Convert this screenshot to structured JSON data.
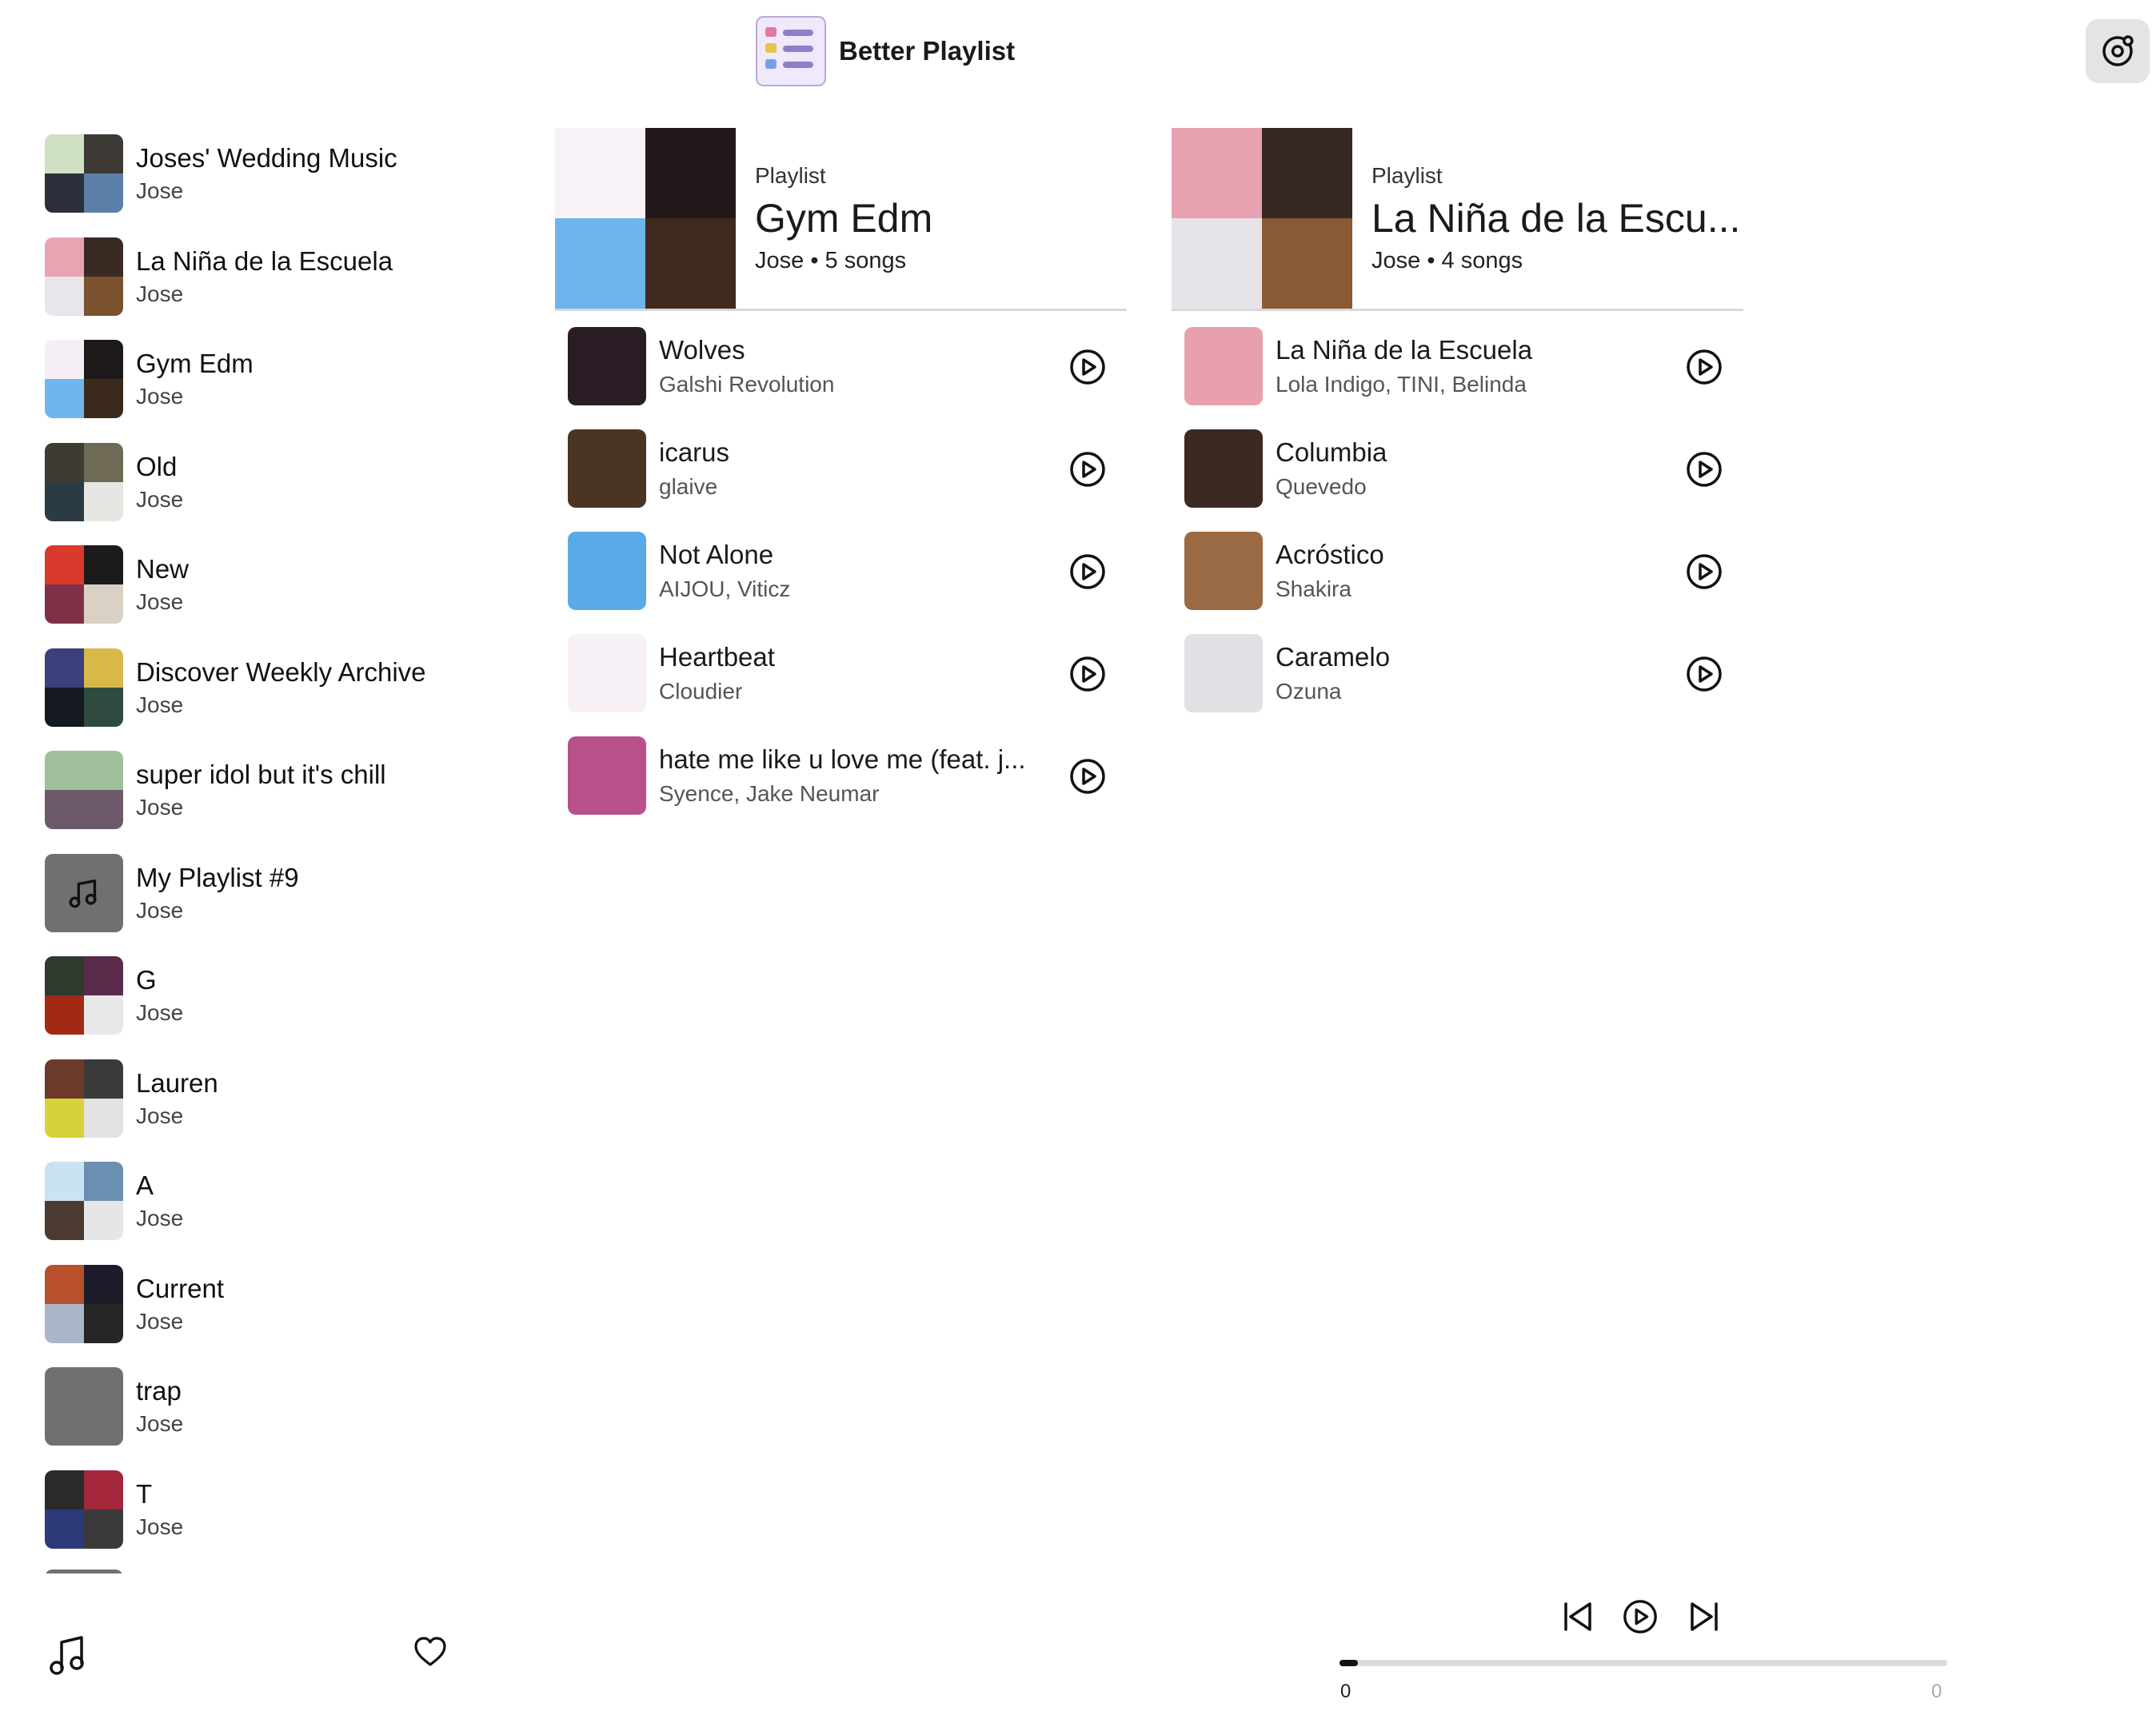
{
  "app": {
    "title": "Better Playlist"
  },
  "icons": {
    "app_logo": "playlist-logo-icon",
    "settings": "spotify-settings-icon",
    "music": "music-note-icon",
    "heart": "heart-icon",
    "play": "play-circle-icon",
    "prev": "skip-previous-icon",
    "next": "skip-next-icon"
  },
  "sidebar": {
    "playlists": [
      {
        "name": "Joses' Wedding Music",
        "owner": "Jose",
        "colors": [
          "#cfe0c4",
          "#3d3a35",
          "#2b2f3a",
          "#5b7fa8"
        ]
      },
      {
        "name": "La Niña de la Escuela",
        "owner": "Jose",
        "colors": [
          "#e9a4b4",
          "#3a2a24",
          "#e8e6ea",
          "#7a5230"
        ]
      },
      {
        "name": "Gym Edm",
        "owner": "Jose",
        "colors": [
          "#f6eef6",
          "#1f1a1a",
          "#6fb6ee",
          "#3a2a1c"
        ]
      },
      {
        "name": "Old",
        "owner": "Jose",
        "colors": [
          "#3e3b33",
          "#6e6a55",
          "#2a3b44",
          "#e6e6e2"
        ]
      },
      {
        "name": "New",
        "owner": "Jose",
        "colors": [
          "#d93a2c",
          "#1b1b1b",
          "#803046",
          "#d9d2c4"
        ]
      },
      {
        "name": "Discover Weekly Archive",
        "owner": "Jose",
        "colors": [
          "#3b3f7a",
          "#d9b84a",
          "#141820",
          "#2f4b40"
        ]
      },
      {
        "name": "super idol but it's chill",
        "owner": "Jose",
        "colors": [
          "#9fbf9a",
          "#9fbf9a",
          "#6c5a6a",
          "#6c5a6a"
        ]
      },
      {
        "name": "My Playlist #9",
        "owner": "Jose",
        "colors": []
      },
      {
        "name": "G",
        "owner": "Jose",
        "colors": [
          "#2e3a2e",
          "#5a2a4a",
          "#a02a14",
          "#e8e8e8"
        ]
      },
      {
        "name": "Lauren",
        "owner": "Jose",
        "colors": [
          "#6b3a2a",
          "#3a3a3a",
          "#d8d23a",
          "#e2e2e2"
        ]
      },
      {
        "name": "A",
        "owner": "Jose",
        "colors": [
          "#c9e3f3",
          "#6b8fb0",
          "#4a3a30",
          "#e6e6e6"
        ]
      },
      {
        "name": "Current",
        "owner": "Jose",
        "colors": [
          "#b8502c",
          "#1c1c2a",
          "#a9b6c8",
          "#262626"
        ]
      },
      {
        "name": "trap",
        "owner": "Jose",
        "colors": []
      },
      {
        "name": "T",
        "owner": "Jose",
        "colors": [
          "#2a2a2a",
          "#a3263a",
          "#2c3a7a",
          "#3a3a3a"
        ]
      }
    ]
  },
  "panels": [
    {
      "type": "Playlist",
      "title": "Gym Edm",
      "meta": "Jose • 5 songs",
      "cover": [
        "#f8f2f8",
        "#22181a",
        "#6db5ec",
        "#3e2b1e"
      ],
      "tracks": [
        {
          "title": "Wolves",
          "artist": "Galshi Revolution",
          "color": "#2a1c24"
        },
        {
          "title": "icarus",
          "artist": "glaive",
          "color": "#4a3422"
        },
        {
          "title": "Not Alone",
          "artist": "AIJOU, Viticz",
          "color": "#5aaae8"
        },
        {
          "title": "Heartbeat",
          "artist": "Cloudier",
          "color": "#f7f1f7"
        },
        {
          "title": "hate me like u love me (feat. j...",
          "artist": "Syence, Jake Neumar",
          "color": "#b8508a"
        }
      ]
    },
    {
      "type": "Playlist",
      "title": "La Niña de la Escu...",
      "meta": "Jose • 4 songs",
      "cover": [
        "#e8a2b2",
        "#352822",
        "#e6e4e8",
        "#8a5a34"
      ],
      "tracks": [
        {
          "title": "La Niña de la Escuela",
          "artist": "Lola Indigo, TINI, Belinda",
          "color": "#e8a0b0"
        },
        {
          "title": "Columbia",
          "artist": "Quevedo",
          "color": "#3a2a22"
        },
        {
          "title": "Acróstico",
          "artist": "Shakira",
          "color": "#9a6a44"
        },
        {
          "title": "Caramelo",
          "artist": "Ozuna",
          "color": "#e2e0e4"
        }
      ]
    }
  ],
  "player": {
    "current_time": "0",
    "total_time": "0",
    "progress": 0.03
  }
}
